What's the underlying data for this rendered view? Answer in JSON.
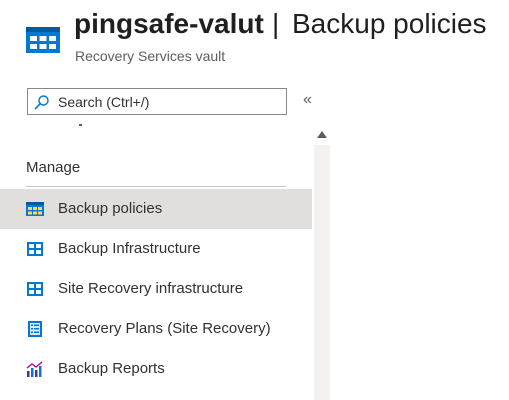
{
  "header": {
    "title": "pingsafe-valut",
    "separator": "|",
    "page": "Backup policies",
    "subtitle": "Recovery Services vault",
    "icon": "recovery-services-vault-icon"
  },
  "search": {
    "placeholder": "Search (Ctrl+/)",
    "icon": "search-icon"
  },
  "collapse": {
    "label": "«"
  },
  "sidebar": {
    "section": "Manage",
    "items": [
      {
        "label": "Backup policies",
        "icon": "backup-policies-icon",
        "active": true
      },
      {
        "label": "Backup Infrastructure",
        "icon": "backup-infrastructure-icon"
      },
      {
        "label": "Site Recovery infrastructure",
        "icon": "site-recovery-infrastructure-icon"
      },
      {
        "label": "Recovery Plans (Site Recovery)",
        "icon": "recovery-plans-icon"
      },
      {
        "label": "Backup Reports",
        "icon": "backup-reports-icon"
      }
    ]
  },
  "colors": {
    "accent": "#0078d4",
    "active_bg": "#e1dfdd",
    "text": "#323130"
  }
}
